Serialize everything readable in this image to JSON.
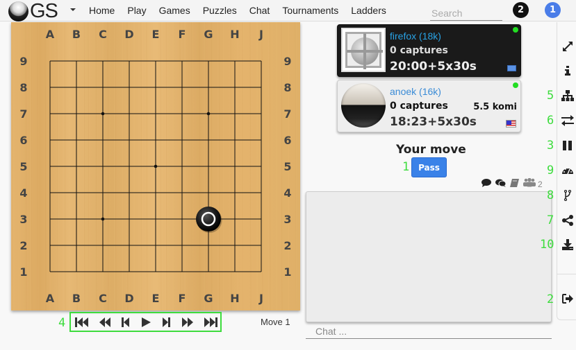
{
  "navbar": {
    "logo_text": "GS",
    "links": [
      "Home",
      "Play",
      "Games",
      "Puzzles",
      "Chat",
      "Tournaments",
      "Ladders"
    ],
    "search_placeholder": "Search",
    "badge_dark": "2",
    "badge_blue": "1"
  },
  "board": {
    "size": 9,
    "columns": [
      "A",
      "B",
      "C",
      "D",
      "E",
      "F",
      "G",
      "H",
      "J"
    ],
    "rows": [
      "9",
      "8",
      "7",
      "6",
      "5",
      "4",
      "3",
      "2",
      "1"
    ],
    "star_points": [
      "C7",
      "G7",
      "E5",
      "C3",
      "G3"
    ],
    "stones": [
      {
        "point": "G3",
        "color": "black",
        "last_move": true
      }
    ]
  },
  "controls": {
    "buttons": [
      "first",
      "back-10",
      "back-1",
      "play",
      "forward-1",
      "forward-10",
      "last"
    ],
    "move_label": "Move 1"
  },
  "players": {
    "black": {
      "name": "firefox (18k)",
      "captures": "0 captures",
      "clock": "20:00+5x30s",
      "online": true,
      "flag": "un"
    },
    "white": {
      "name": "anoek (16k)",
      "captures": "0 captures",
      "komi": "5.5 komi",
      "clock": "18:23+5x30s",
      "online": true,
      "flag": "us"
    }
  },
  "status": {
    "your_move": "Your move",
    "pass_label": "Pass"
  },
  "chat": {
    "spectator_count": "2",
    "input_placeholder": "Chat ..."
  },
  "annotations": {
    "pass": "1",
    "exit": "2",
    "pause": "3",
    "controls": "4",
    "tree": "5",
    "swap": "6",
    "share": "7",
    "fork": "8",
    "speed": "9",
    "download": "10"
  },
  "colors": {
    "accent_blue": "#3a82e8",
    "annotation_green": "#3ddc3d",
    "online_green": "#22dd22"
  }
}
